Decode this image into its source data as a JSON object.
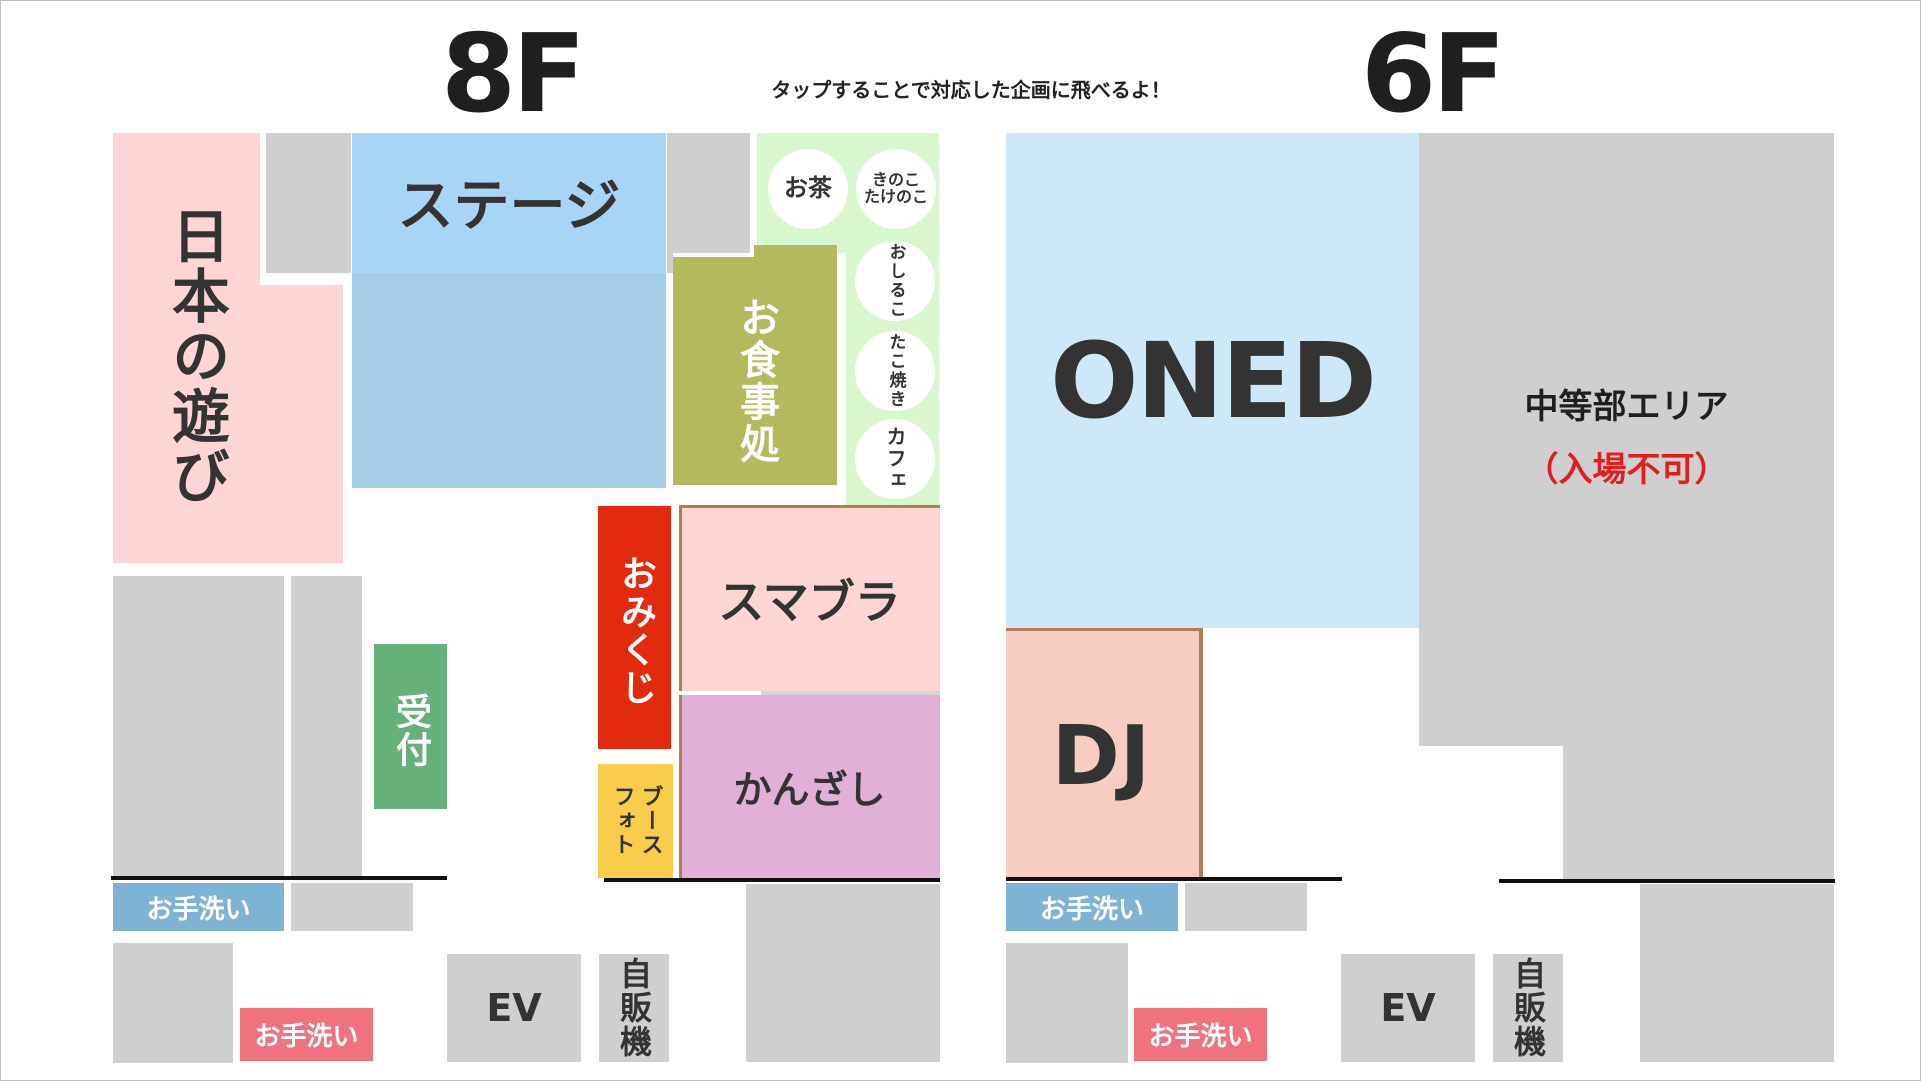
{
  "header": {
    "floor8_title": "8F",
    "floor6_title": "6F",
    "instruction": "タップすることで対応した企画に飛べるよ！"
  },
  "floor8": {
    "japanese_play": "日本の遊び",
    "stage": "ステージ",
    "tea": "お茶",
    "kinoko_line1": "きのこ",
    "kinoko_line2": "たけのこ",
    "oshiruko": "おしるこ",
    "takoyaki": "たこ焼き",
    "cafe": "カフェ",
    "dining": "お食事処",
    "omikuji": "おみくじ",
    "smash": "スマブラ",
    "reception": "受付",
    "photo_line1": "ブース",
    "photo_line2": "フォト",
    "kanzashi": "かんざし",
    "washroom_upper": "お手洗い",
    "washroom_lower": "お手洗い",
    "elevator": "EV",
    "vending": "自販機"
  },
  "floor6": {
    "oned": "ONED",
    "dj": "DJ",
    "middle_school_area": "中等部エリア",
    "no_entry": "（入場不可）",
    "washroom_upper": "お手洗い",
    "washroom_lower": "お手洗い",
    "elevator": "EV",
    "vending": "自販機"
  },
  "colors": {
    "japanese_play": "#fdd5d4",
    "stage_top": "#a9d5f5",
    "stage_bottom": "#a6cde6",
    "dining": "#b5b95e",
    "cafe_strip": "#d9f7cf",
    "omikuji": "#e22a0e",
    "smash": "#fdd6d4",
    "kanzashi": "#e0b0d6",
    "reception": "#66b07a",
    "photo": "#f8cd4b",
    "oned": "#cfe8f8",
    "dj": "#f5cdc2",
    "no_entry_text": "#e11e1e",
    "washroom_blue": "#7fb3d6",
    "washroom_pink": "#f0727f",
    "grey": "#cfcfcf"
  }
}
